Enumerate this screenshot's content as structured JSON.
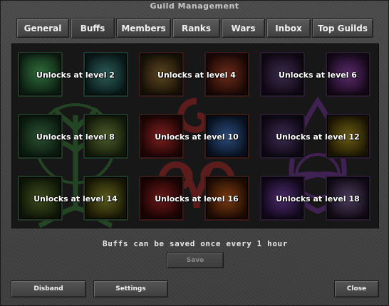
{
  "window": {
    "title": "Guild Management"
  },
  "tabs": [
    {
      "label": "General"
    },
    {
      "label": "Buffs",
      "active": true
    },
    {
      "label": "Members"
    },
    {
      "label": "Ranks"
    },
    {
      "label": "Wars"
    },
    {
      "label": "Inbox"
    },
    {
      "label": "Top Guilds"
    }
  ],
  "buffs": {
    "groups": [
      {
        "color": "#2e7d32",
        "symbol": "tree-icon",
        "rows": [
          {
            "label": "Unlocks at level 2"
          },
          {
            "label": "Unlocks at level 8"
          },
          {
            "label": "Unlocks at level 14"
          }
        ]
      },
      {
        "color": "#c62828",
        "symbol": "triskelion-icon",
        "rows": [
          {
            "label": "Unlocks at level 4"
          },
          {
            "label": "Unlocks at level 10"
          },
          {
            "label": "Unlocks at level 16"
          }
        ]
      },
      {
        "color": "#6a1b9a",
        "symbol": "triquetra-icon",
        "rows": [
          {
            "label": "Unlocks at level 6"
          },
          {
            "label": "Unlocks at level 12"
          },
          {
            "label": "Unlocks at level 18"
          }
        ]
      }
    ],
    "note": "Buffs can be saved once every 1 hour",
    "save_label": "Save"
  },
  "footer": {
    "disband_label": "Disband",
    "settings_label": "Settings",
    "close_label": "Close"
  }
}
